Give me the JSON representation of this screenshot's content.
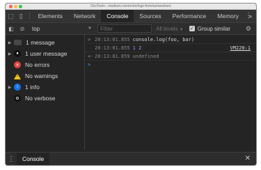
{
  "window": {
    "title": "DevTools - medium.com/en/m/logs-from/somewhere"
  },
  "tabs": [
    {
      "label": "Elements"
    },
    {
      "label": "Network"
    },
    {
      "label": "Console"
    },
    {
      "label": "Sources"
    },
    {
      "label": "Performance"
    },
    {
      "label": "Memory"
    }
  ],
  "tabs_more": "»",
  "toolbar": {
    "context": "top",
    "filter_placeholder": "Filter",
    "levels": "All levels",
    "group_similar": "Group similar",
    "group_similar_checked": true
  },
  "sidebar": {
    "items": [
      {
        "label": "1 message",
        "icon": "messages-icon",
        "expandable": true
      },
      {
        "label": "1 user message",
        "icon": "user-icon",
        "expandable": true
      },
      {
        "label": "No errors",
        "icon": "error-icon",
        "expandable": false
      },
      {
        "label": "No warnings",
        "icon": "warning-icon",
        "expandable": false
      },
      {
        "label": "1 info",
        "icon": "info-icon",
        "expandable": true
      },
      {
        "label": "No verbose",
        "icon": "verbose-icon",
        "expandable": false
      }
    ]
  },
  "console": {
    "lines": [
      {
        "prefix": ">",
        "timestamp": "20:13:01.855",
        "code": "console.log(foo, bar)"
      },
      {
        "prefix": "",
        "timestamp": "20:13:01.855",
        "values": [
          "1",
          "2"
        ],
        "source": "VM220:1"
      },
      {
        "prefix": "<·",
        "timestamp": "20:13:01.859",
        "result": "undefined"
      }
    ],
    "prompt": ">"
  },
  "drawer": {
    "tab": "Console"
  },
  "colors": {
    "background": "#242424",
    "panel": "#2d2d2d",
    "error": "#e0443e",
    "warning": "#f2c11a",
    "info": "#1a73e8",
    "number": "#9b8cf5"
  }
}
